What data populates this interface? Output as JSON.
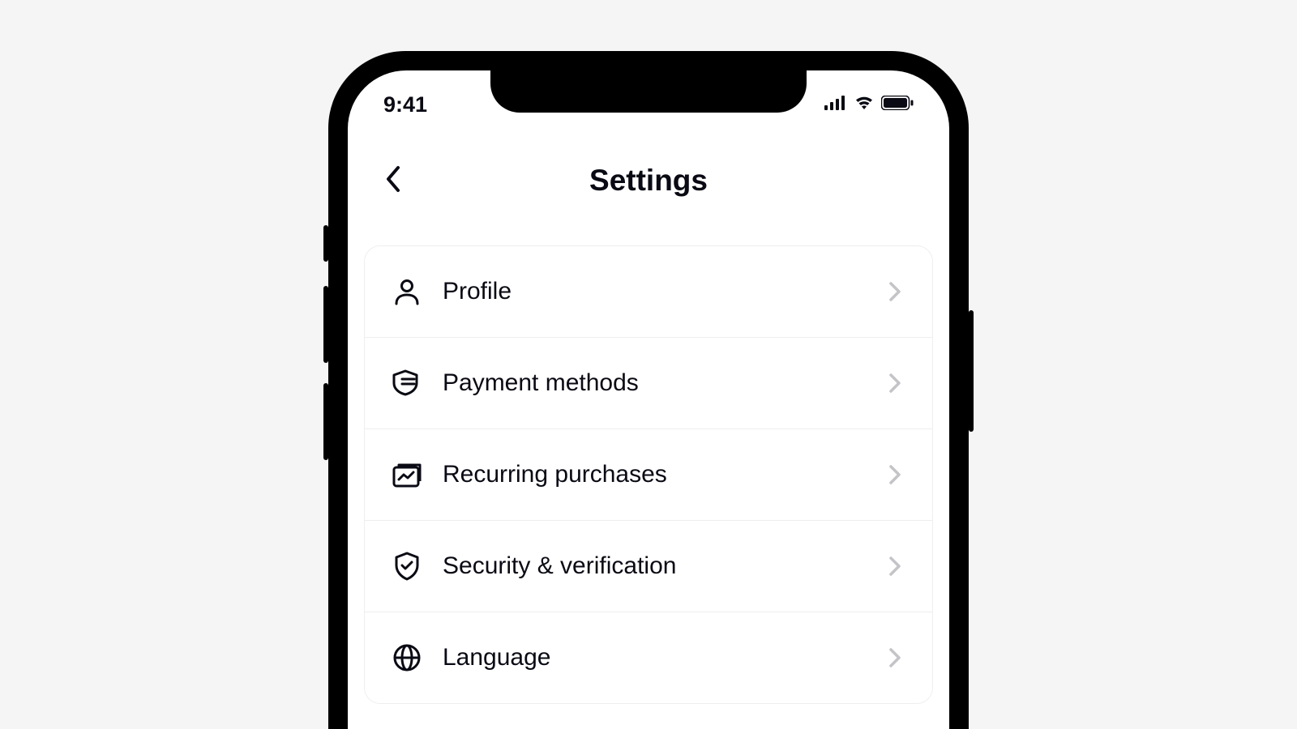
{
  "status_bar": {
    "time": "9:41"
  },
  "header": {
    "title": "Settings"
  },
  "settings": {
    "items": [
      {
        "label": "Profile",
        "icon": "user-icon"
      },
      {
        "label": "Payment methods",
        "icon": "payment-icon"
      },
      {
        "label": "Recurring purchases",
        "icon": "recurring-icon"
      },
      {
        "label": "Security & verification",
        "icon": "shield-check-icon"
      },
      {
        "label": "Language",
        "icon": "globe-icon"
      }
    ]
  }
}
